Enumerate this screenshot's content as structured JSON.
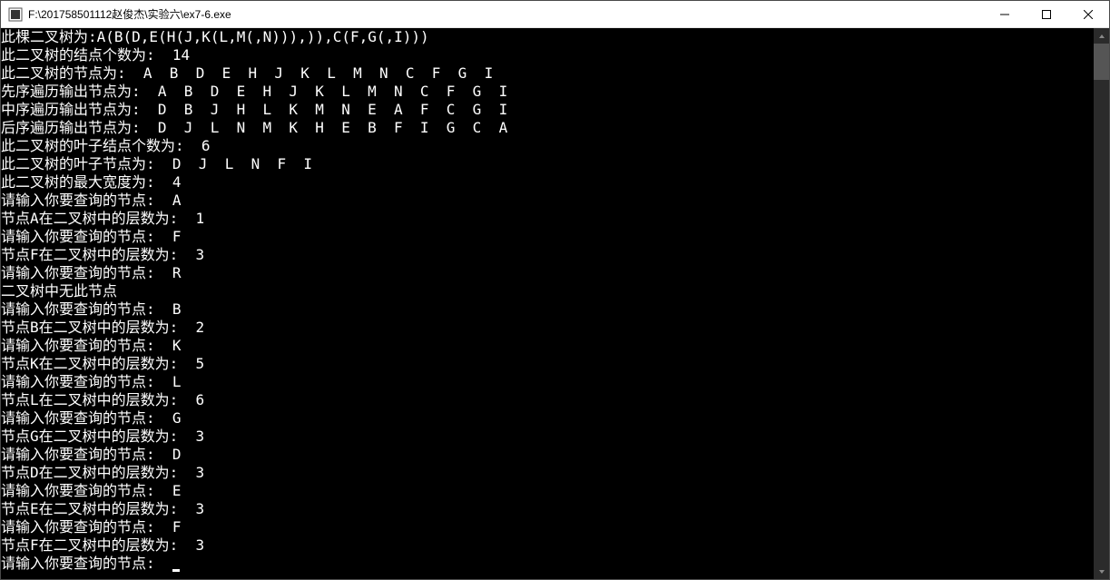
{
  "window": {
    "title": "F:\\201758501112赵俊杰\\实验六\\ex7-6.exe"
  },
  "console": {
    "lines": [
      "此棵二叉树为:A(B(D,E(H(J,K(L,M(,N))),)),C(F,G(,I)))",
      "此二叉树的结点个数为:  14",
      "此二叉树的节点为:  A  B  D  E  H  J  K  L  M  N  C  F  G  I",
      "先序遍历输出节点为:  A  B  D  E  H  J  K  L  M  N  C  F  G  I",
      "中序遍历输出节点为:  D  B  J  H  L  K  M  N  E  A  F  C  G  I",
      "后序遍历输出节点为:  D  J  L  N  M  K  H  E  B  F  I  G  C  A",
      "此二叉树的叶子结点个数为:  6",
      "此二叉树的叶子节点为:  D  J  L  N  F  I",
      "此二叉树的最大宽度为:  4",
      "请输入你要查询的节点:  A",
      "节点A在二叉树中的层数为:  1",
      "请输入你要查询的节点:  F",
      "节点F在二叉树中的层数为:  3",
      "请输入你要查询的节点:  R",
      "二叉树中无此节点",
      "请输入你要查询的节点:  B",
      "节点B在二叉树中的层数为:  2",
      "请输入你要查询的节点:  K",
      "节点K在二叉树中的层数为:  5",
      "请输入你要查询的节点:  L",
      "节点L在二叉树中的层数为:  6",
      "请输入你要查询的节点:  G",
      "节点G在二叉树中的层数为:  3",
      "请输入你要查询的节点:  D",
      "节点D在二叉树中的层数为:  3",
      "请输入你要查询的节点:  E",
      "节点E在二叉树中的层数为:  3",
      "请输入你要查询的节点:  F",
      "节点F在二叉树中的层数为:  3",
      "请输入你要查询的节点:  "
    ]
  }
}
